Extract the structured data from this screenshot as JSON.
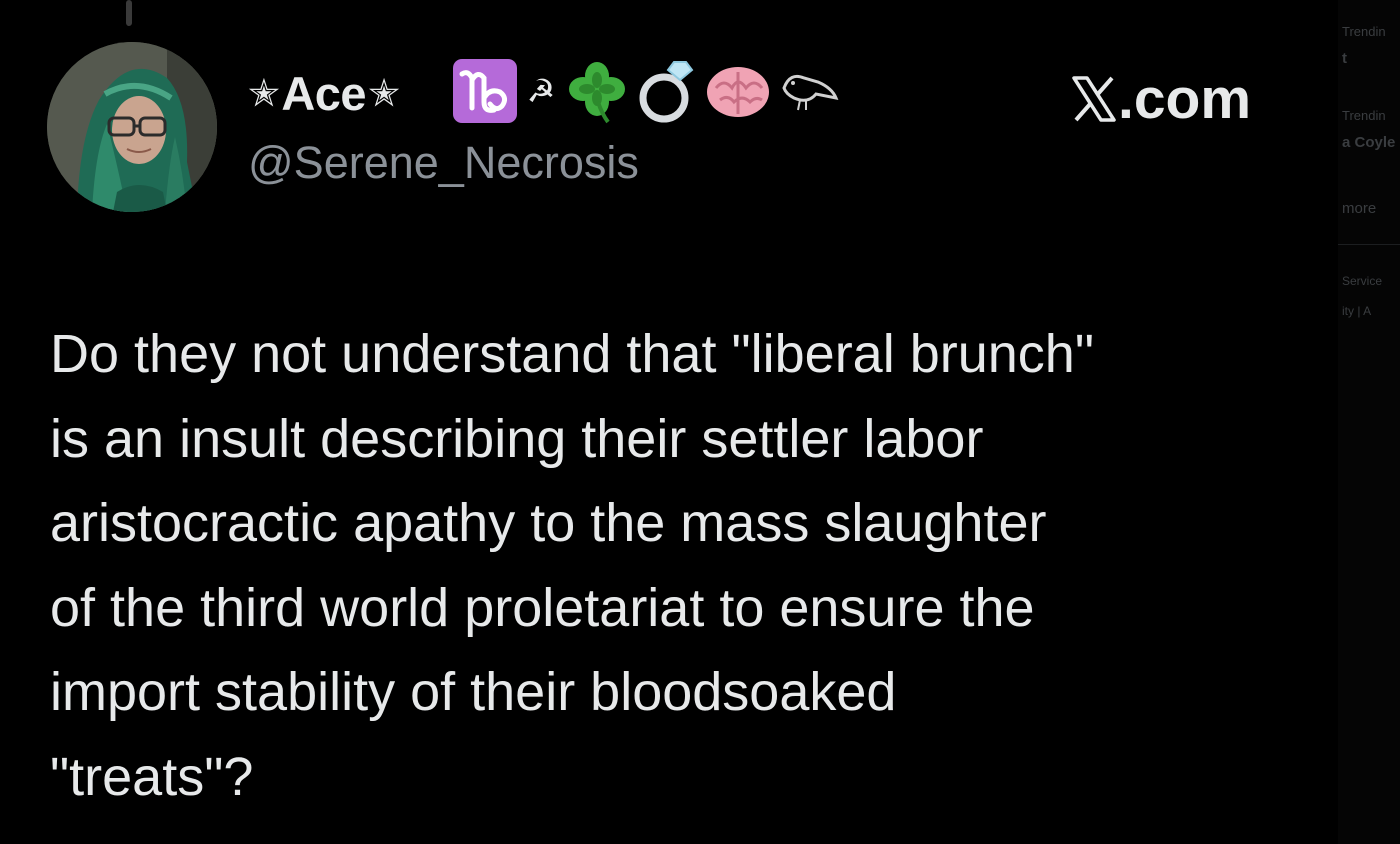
{
  "tweet": {
    "display_name_prefix": "✭",
    "display_name_text": "Ace",
    "display_name_suffix": "✭",
    "badges": [
      "capricorn-icon",
      "hammer-sickle-icon",
      "four-leaf-clover-icon",
      "ring-icon",
      "brain-icon",
      "bird-icon"
    ],
    "hammer_sickle": "☭",
    "handle": "@Serene_Necrosis",
    "watermark": ".com",
    "body_lines": [
      "Do they not understand that \"liberal brunch\"",
      "is an insult describing their settler labor",
      "aristocractic apathy to the mass slaughter",
      "of the third world proletariat to ensure the",
      "import stability of their bloodsoaked",
      "\"treats\"?"
    ]
  },
  "sidebar": {
    "item1_label": "Trendin",
    "item1_sub": "t",
    "item2_label": "Trendin",
    "item2_sub": "a Coyle",
    "more": "more",
    "footer1": "Service",
    "footer2": "ity  |  A"
  },
  "colors": {
    "background": "#000000",
    "text_primary": "#e7e9ea",
    "text_secondary": "#8b9198",
    "capricorn_badge": "#b56ad9"
  }
}
